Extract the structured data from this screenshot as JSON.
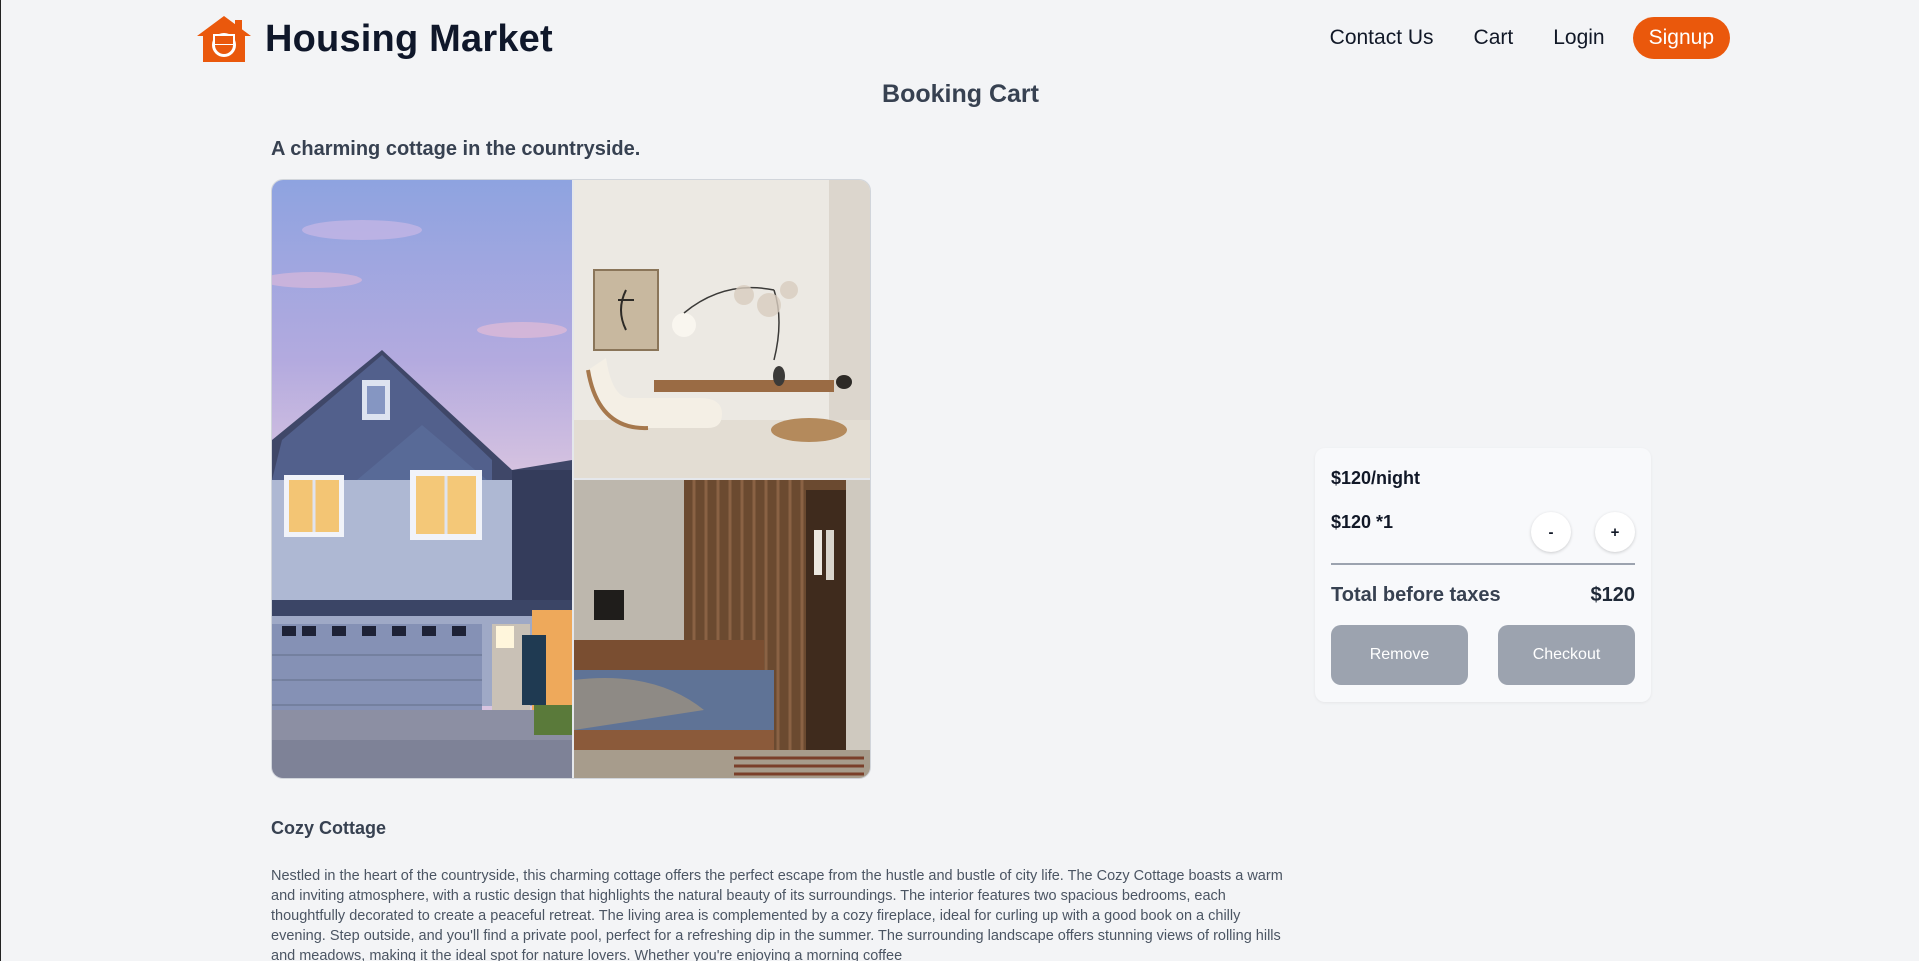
{
  "brand": {
    "name": "Housing Market",
    "icon": "house-smile-logo",
    "accent": "#ea580c"
  },
  "nav": {
    "contact": "Contact Us",
    "cart": "Cart",
    "login": "Login",
    "signup": "Signup"
  },
  "page": {
    "title": "Booking Cart"
  },
  "listing": {
    "headline": "A charming cottage in the countryside.",
    "name": "Cozy Cottage",
    "description": "Nestled in the heart of the countryside, this charming cottage offers the perfect escape from the hustle and bustle of city life. The Cozy Cottage boasts a warm and inviting atmosphere, with a rustic design that highlights the natural beauty of its surroundings. The interior features two spacious bedrooms, each thoughtfully decorated to create a peaceful retreat. The living area is complemented by a cozy fireplace, ideal for curling up with a good book on a chilly evening. Step outside, and you'll find a private pool, perfect for a refreshing dip in the summer. The surrounding landscape offers stunning views of rolling hills and meadows, making it the ideal spot for nature lovers. Whether you're enjoying a morning coffee"
  },
  "booking": {
    "rate": "$120/night",
    "quantity_line": "$120 *1",
    "minus": "-",
    "plus": "+",
    "total_label": "Total before taxes",
    "total_value": "$120",
    "remove": "Remove",
    "checkout": "Checkout",
    "button_color": "#9ca3af"
  }
}
